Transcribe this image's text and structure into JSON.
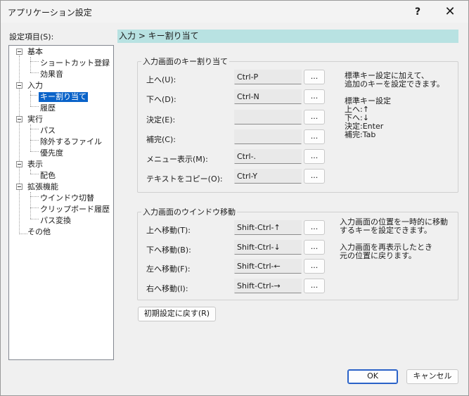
{
  "window": {
    "title": "アプリケーション設定",
    "help_symbol": "?",
    "close_symbol": "✕"
  },
  "settings_label": "設定項目(S):",
  "tree": [
    {
      "label": "基本"
    },
    {
      "label": "ショートカット登録"
    },
    {
      "label": "効果音"
    },
    {
      "label": "入力"
    },
    {
      "label": "キー割り当て",
      "selected": true
    },
    {
      "label": "履歴"
    },
    {
      "label": "実行"
    },
    {
      "label": "パス"
    },
    {
      "label": "除外するファイル"
    },
    {
      "label": "優先度"
    },
    {
      "label": "表示"
    },
    {
      "label": "配色"
    },
    {
      "label": "拡張機能"
    },
    {
      "label": "ウインドウ切替"
    },
    {
      "label": "クリップボード履歴"
    },
    {
      "label": "パス変換"
    },
    {
      "label": "その他"
    }
  ],
  "header_path": "入力 > キー割り当て",
  "key_group": {
    "title": "入力画面のキー割り当て",
    "rows": [
      {
        "label": "上へ(U):",
        "value": "Ctrl-P"
      },
      {
        "label": "下へ(D):",
        "value": "Ctrl-N"
      },
      {
        "label": "決定(E):",
        "value": ""
      },
      {
        "label": "補完(C):",
        "value": ""
      },
      {
        "label": "メニュー表示(M):",
        "value": "Ctrl-."
      },
      {
        "label": "テキストをコピー(O):",
        "value": "Ctrl-Y"
      }
    ],
    "note_lines": [
      "標準キー設定に加えて、",
      "追加のキーを設定できます。",
      "",
      "標準キー設定",
      "上へ:↑",
      "下へ:↓",
      "決定:Enter",
      "補完:Tab"
    ]
  },
  "move_group": {
    "title": "入力画面のウインドウ移動",
    "rows": [
      {
        "label": "上へ移動(T):",
        "value": "Shift-Ctrl-↑"
      },
      {
        "label": "下へ移動(B):",
        "value": "Shift-Ctrl-↓"
      },
      {
        "label": "左へ移動(F):",
        "value": "Shift-Ctrl-←"
      },
      {
        "label": "右へ移動(I):",
        "value": "Shift-Ctrl-→"
      }
    ],
    "note_lines": [
      "入力画面の位置を一時的に移動",
      "するキーを設定できます。",
      "",
      "入力画面を再表示したとき",
      "元の位置に戻ります。"
    ]
  },
  "browse_label": "...",
  "reset_label": "初期設定に戻す(R)",
  "ok_label": "OK",
  "cancel_label": "キャンセル"
}
